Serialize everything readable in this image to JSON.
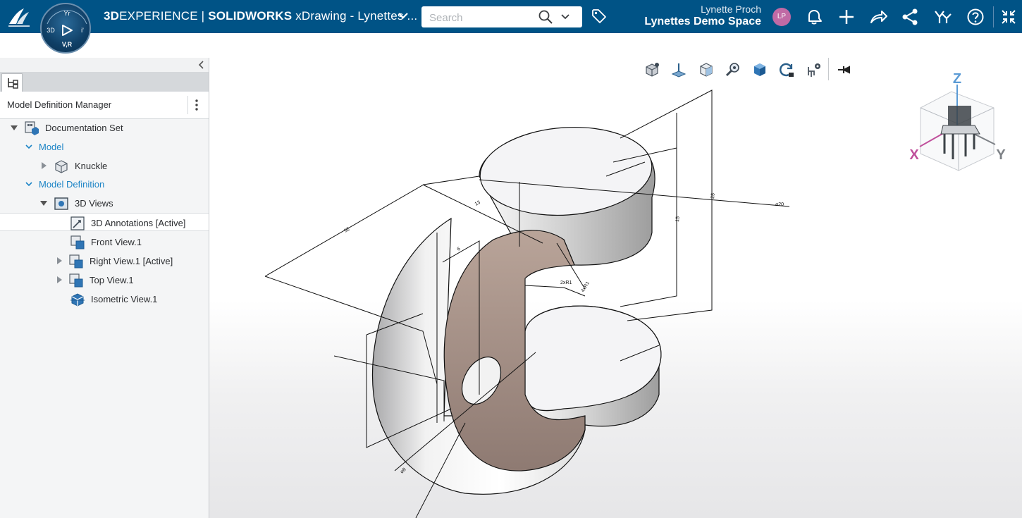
{
  "topbar": {
    "brand_bold": "3D",
    "brand_rest": "EXPERIENCE",
    "separator": " | ",
    "app_name": "SOLIDWORKS",
    "doc_title": " xDrawing - Lynettes ...",
    "compass_labels": {
      "top": "Yr",
      "left": "3D",
      "right": "i'",
      "bottom": "V,R"
    },
    "search": {
      "placeholder": "Search"
    },
    "user_name": "Lynette Proch",
    "space_name": "Lynettes Demo Space",
    "avatar_initials": "LP",
    "icons": [
      "tag-icon",
      "notifications-icon",
      "add-icon",
      "share-icon",
      "social-share-icon",
      "community-icon",
      "help-icon",
      "fullscreen-exit-icon"
    ],
    "colors": {
      "bar": "#005386",
      "avatar": "#c06aa5"
    }
  },
  "panel": {
    "title": "Model Definition Manager",
    "tree": [
      {
        "label": "Documentation Set",
        "icon": "documentation-set-icon"
      },
      {
        "label": "Model",
        "icon": ""
      },
      {
        "label": "Knuckle",
        "icon": "part-icon"
      },
      {
        "label": "Model Definition",
        "icon": ""
      },
      {
        "label": "3D Views",
        "icon": "3d-views-icon"
      },
      {
        "label": "3D Annotations [Active]",
        "icon": "annotations-icon"
      },
      {
        "label": "Front View.1",
        "icon": "view-icon"
      },
      {
        "label": "Right View.1 [Active]",
        "icon": "view-icon"
      },
      {
        "label": "Top View.1",
        "icon": "view-icon"
      },
      {
        "label": "Isometric View.1",
        "icon": "isometric-view-icon"
      }
    ]
  },
  "viewport": {
    "toolbar_icons": [
      "view-cube-icon",
      "plane-icon",
      "box-view-icon",
      "zoom-icon",
      "shaded-cube-icon",
      "rotate-lock-icon",
      "settings-chair-icon",
      "pin-icon"
    ],
    "triad_labels": {
      "z": "Z",
      "x": "X",
      "y": "Y"
    },
    "dimension_labels": [
      "52",
      "13",
      "6",
      "25",
      "15",
      "⌀20",
      "2xR1",
      "4xR1",
      "⌀8"
    ]
  }
}
